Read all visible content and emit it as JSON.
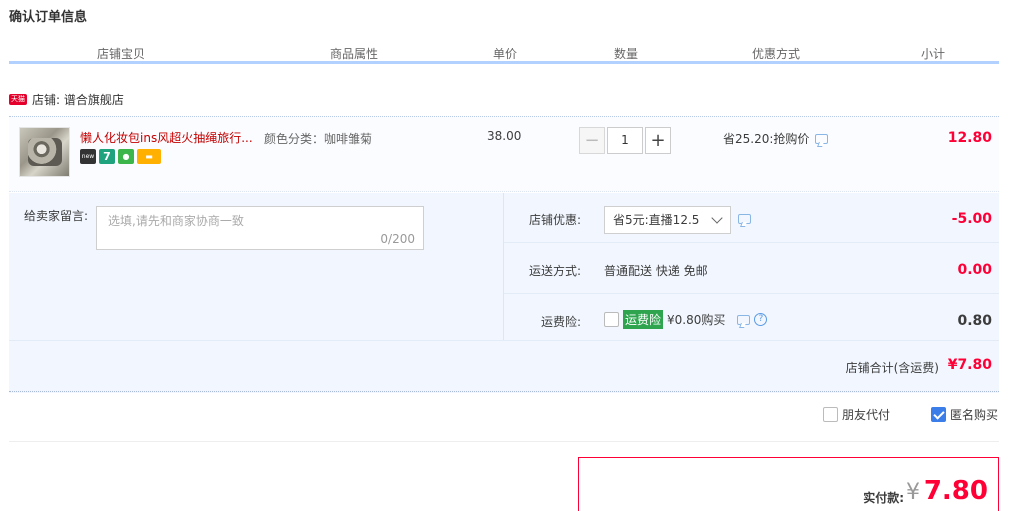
{
  "page": {
    "title": "确认订单信息"
  },
  "table_header": {
    "columns": [
      "店铺宝贝",
      "商品属性",
      "单价",
      "数量",
      "优惠方式",
      "小计"
    ]
  },
  "shop": {
    "badge": "天猫",
    "label": "店铺: 谱合旗舰店"
  },
  "item": {
    "name": "懒人化妆包ins风超火抽绳旅行...",
    "badges": [
      "new",
      "7",
      "bulb",
      "card"
    ],
    "attribute": "颜色分类：咖啡雏菊",
    "unit_price": "38.00",
    "quantity": "1",
    "minus_label": "−",
    "plus_label": "+",
    "promo": "省25.20:抢购价",
    "subtotal": "12.80"
  },
  "memo": {
    "label": "给卖家留言:",
    "placeholder": "选填,请先和商家协商一致",
    "counter": "0/200"
  },
  "options": {
    "shop_discount": {
      "label": "店铺优惠:",
      "selected": "省5元:直播12.5",
      "amount": "-5.00"
    },
    "shipping": {
      "label": "运送方式:",
      "value": "普通配送 快递 免邮",
      "amount": "0.00"
    },
    "insurance": {
      "label": "运费险:",
      "tag": "运费险",
      "value": "¥0.80购买",
      "help": "?",
      "amount": "0.80",
      "checked": false
    }
  },
  "shop_total": {
    "label": "店铺合计(含运费)",
    "amount": "¥7.80"
  },
  "purchase_options": {
    "friend_pay": {
      "label": "朋友代付",
      "checked": false
    },
    "anonymous": {
      "label": "匿名购买",
      "checked": true
    }
  },
  "payment": {
    "label": "实付款:",
    "currency": "¥",
    "amount": "7.80"
  },
  "colors": {
    "accent_red": "#ff0036",
    "header_border": "#b2d1ff",
    "panel_bg": "#f2f7ff"
  }
}
